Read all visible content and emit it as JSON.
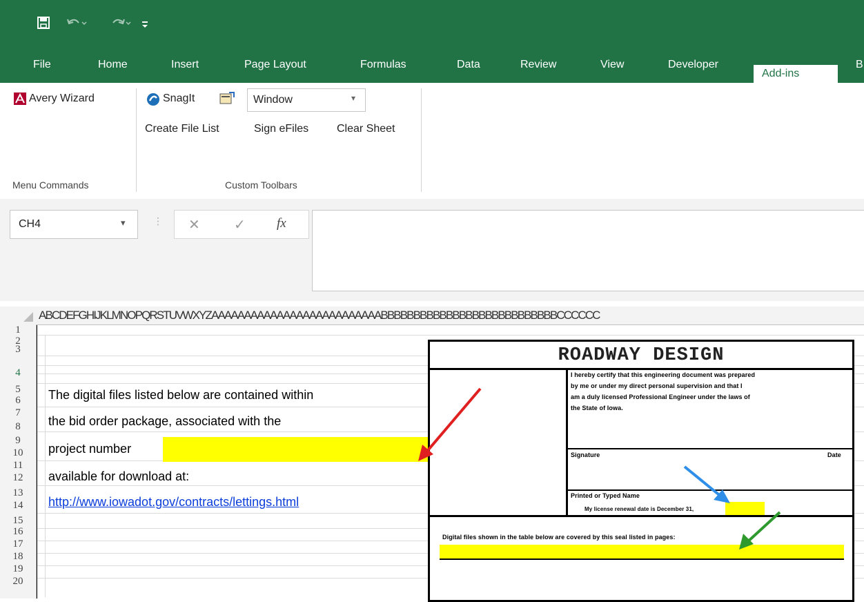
{
  "qat": {
    "save_icon": "save-icon",
    "undo_icon": "undo-icon",
    "redo_icon": "redo-icon",
    "customize_icon": "customize-icon"
  },
  "tabs": [
    "File",
    "Home",
    "Insert",
    "Page Layout",
    "Formulas",
    "Data",
    "Review",
    "View",
    "Developer",
    "Add-ins",
    "B"
  ],
  "active_tab": "Add-ins",
  "ribbon": {
    "avery_wizard": "Avery Wizard",
    "menu_commands": "Menu Commands",
    "snagit": "SnagIt",
    "capture_mode": "Window",
    "create_file_list": "Create File List",
    "sign_efiles": "Sign eFiles",
    "clear_sheet": "Clear Sheet",
    "custom_toolbars": "Custom Toolbars"
  },
  "formula_bar": {
    "name_box": "CH4",
    "fx": "fx",
    "formula": ""
  },
  "columns": "ABCDEFGHIJKLMNOPQRSTUVWXYZAAAAAAAAAAAAAAAAAAAAAAAAAABBBBBBBBBBBBBBBBBBBBBBBBBBBCCCCCC",
  "rows": [
    "1",
    "2",
    "3",
    "4",
    "5",
    "6",
    "7",
    "8",
    "9",
    "10",
    "11",
    "12",
    "13",
    "14",
    "15",
    "16",
    "17",
    "18",
    "19",
    "20"
  ],
  "sheet": {
    "line1": "The digital files listed below are contained within",
    "line2": "the bid order package, associated with the",
    "line3": "project number",
    "line4": "available for download at:",
    "link": "http://www.iowadot.gov/contracts/lettings.html"
  },
  "cert": {
    "title": "ROADWAY DESIGN",
    "cert_text_1": "I hereby certify that this engineering document was prepared",
    "cert_text_2": "by me or under my direct personal supervision and that I",
    "cert_text_3": "am a duly licensed Professional Engineer under the laws of",
    "cert_text_4": "the State of Iowa.",
    "signature": "Signature",
    "date": "Date",
    "printed_name": "Printed or Typed Name",
    "license_renewal": "My license renewal date is December 31,",
    "digital_files": "Digital files shown in the table below are covered by this seal listed in pages:"
  },
  "colors": {
    "ribbon_green": "#217346",
    "highlight": "#ffff00",
    "arrow_red": "#e02020",
    "arrow_blue": "#2f8fe8",
    "arrow_green": "#2e9a2e"
  }
}
